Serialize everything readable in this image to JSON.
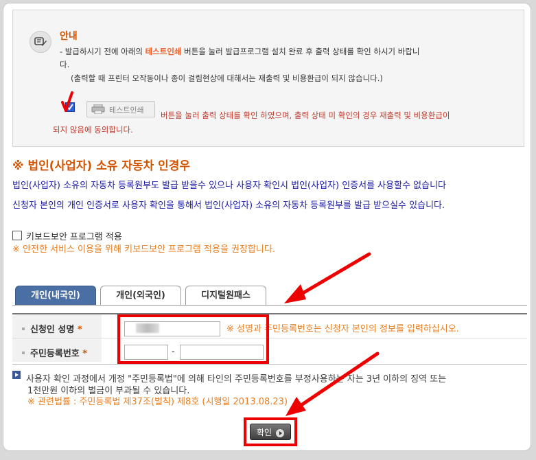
{
  "notice": {
    "title": "안내",
    "line1_prefix": "- 발급하시기 전에 아래의 ",
    "line1_bold": "테스트인쇄",
    "line1_suffix": " 버튼을 눌러 발급프로그램 설치 완료 후 출력 상태를 확인 하시기 바랍니",
    "line2": "다.",
    "line3": "(출력할 때 프린터 오작동이나 종이 걸림현상에 대해서는 재출력 및 비용환급이 되지 않습니다.)",
    "test_button_label": "테스트인쇄",
    "agree_line1": "버튼을 눌러 출력 상태를 확인 하였으며, 출력 상태 미 확인의 경우 재출력 및 비용환급이",
    "agree_line2": "되지 않음에 동의합니다."
  },
  "corporate": {
    "title": "※ 법인(사업자) 소유 자동차 인경우",
    "line1": "법인(사업자) 소유의 자동차 등록원부도 발급 받을수 있으나 사용자 확인시 법인(사업자) 인증서를 사용할수 없습니다",
    "line2": "신청자 본인의 개인 인증서로 사용자 확인을 통해서 법인(사업자) 소유의 자동차 등록원부를 발급 받으실수 있습니다."
  },
  "keyboard": {
    "label": "키보드보안 프로그램 적용",
    "note": "※ 안전한 서비스 이용을 위해 키보드보안 프로그램 적용을 권장합니다."
  },
  "tabs": [
    {
      "label": "개인(내국인)"
    },
    {
      "label": "개인(외국인)"
    },
    {
      "label": "디지털원패스"
    }
  ],
  "form": {
    "name_label": "신청인 성명",
    "required_star": "*",
    "id_label": "주민등록번호",
    "name_note": "※ 성명과 주민등록번호는 신청자 본인의 정보를 입력하십시오.",
    "id_separator": "-"
  },
  "warning": {
    "line1": "사용자 확인 과정에서 개정 \"주민등록법\"에 의해 타인의 주민등록번호를 부정사용하는 자는 3년 이하의 징역 또는",
    "line2": "1천만원 이하의 벌금이 부과될 수 있습니다.",
    "law": "※ 관련법률 : 주민등록법 제37조(벌칙) 제8호 (시행일 2013.08.23)"
  },
  "confirm_label": "확인",
  "colors": {
    "accent": "#d35400",
    "blue_text": "#1a1aa8",
    "annotation_red": "#e00000",
    "active_tab": "#4a6fa5"
  }
}
